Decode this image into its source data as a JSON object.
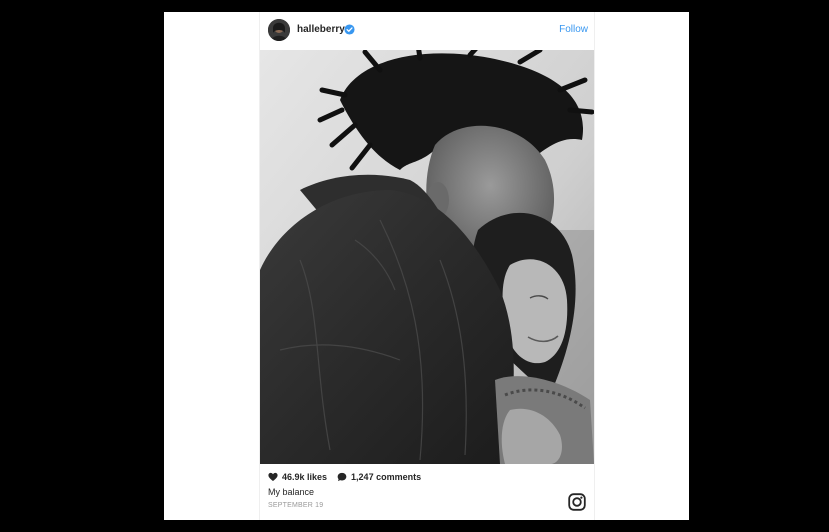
{
  "post": {
    "username": "halleberry",
    "follow_label": "Follow",
    "likes": "46.9k likes",
    "comments": "1,247 comments",
    "caption": "My balance",
    "date": "SEPTEMBER 19"
  },
  "colors": {
    "follow_blue": "#3897f0",
    "verified_blue": "#3897f0",
    "text": "#262626",
    "muted": "#999999"
  },
  "icons": {
    "verified": "verified-badge-icon",
    "likes": "heart-icon",
    "comments": "comment-bubble-icon",
    "brand": "instagram-icon"
  }
}
